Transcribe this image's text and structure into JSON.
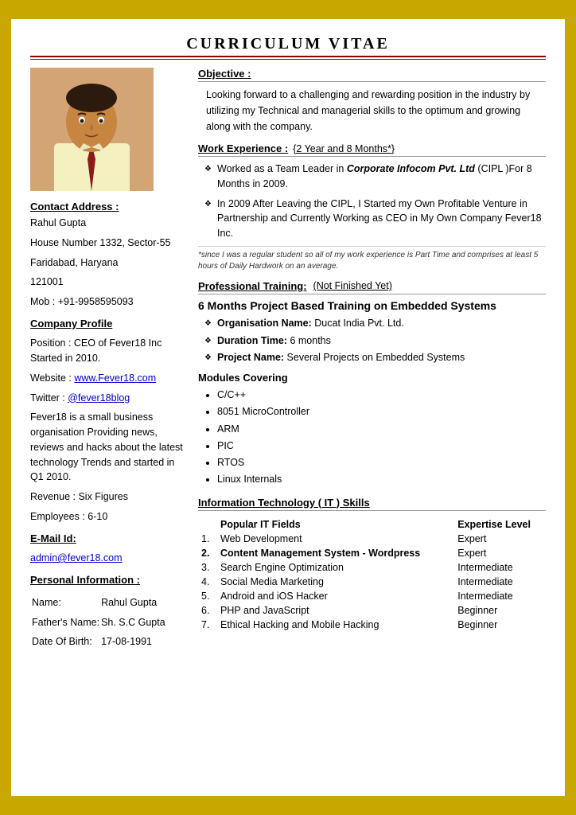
{
  "page": {
    "title": "CURRICULUM VITAE"
  },
  "left": {
    "contact_label": "Contact  Address :",
    "name": "Rahul Gupta",
    "address1": "House Number 1332, Sector-55",
    "address2": "Faridabad, Haryana",
    "pincode": "121001",
    "mobile": "Mob : +91-9958595093",
    "company_profile_label": "Company Profile",
    "position": "Position : CEO of Fever18 Inc Started in 2010.",
    "website_label": "Website : ",
    "website_text": "www.Fever18.com",
    "website_url": "http://www.Fever18.com",
    "twitter_label": "Twitter : ",
    "twitter_text": "@fever18blog",
    "twitter_url": "http://twitter.com/fever18blog",
    "company_desc": "Fever18 is a small business organisation Providing news, reviews and hacks about the latest technology Trends and started in Q1 2010.",
    "revenue": "Revenue : Six Figures",
    "employees": "Employees : 6-10",
    "email_label": "E-Mail Id:",
    "email_text": "admin@fever18.com",
    "email_url": "mailto:admin@fever18.com",
    "personal_label": "Personal   Information :",
    "name_label": "Name:",
    "name_val": "Rahul Gupta",
    "father_label": "Father's Name:",
    "father_val": "Sh. S.C Gupta",
    "dob_label": "Date  Of  Birth:",
    "dob_val": "17-08-1991"
  },
  "right": {
    "objective_label": "Objective :",
    "objective_text": "Looking forward to a challenging and rewarding position in the industry by utilizing my Technical and managerial skills to the optimum and growing along with the company.",
    "work_exp_label": "Work Experience :",
    "work_exp_duration": "{2 Year and 8 Months*}",
    "work_item1_pre": "Worked as a Team Leader in ",
    "work_item1_italic": "Corporate Infocom Pvt. Ltd",
    "work_item1_post": " (CIPL )For 8 Months in 2009.",
    "work_item2": "In 2009 After Leaving the CIPL, I Started my Own Profitable Venture in Partnership and Currently Working as CEO in My Own Company Fever18 Inc.",
    "work_note": "*since  I was a regular student so all of my work experience is Part Time and comprises at least 5 hours of Daily Hardwork on an average.",
    "prof_training_label": "Professional Training:",
    "prof_training_status": "(Not Finished Yet)",
    "training_title": "6 Months Project Based Training on Embedded Systems",
    "org_label": "Organisation Name:",
    "org_val": "Ducat India Pvt. Ltd.",
    "duration_label": "Duration Time:",
    "duration_val": "6 months",
    "project_label": "Project Name:",
    "project_val": "Several Projects on Embedded Systems",
    "modules_label": "Modules Covering",
    "modules": [
      "C/C++",
      "8051 MicroController",
      "ARM",
      "PIC",
      "RTOS",
      "Linux Internals"
    ],
    "it_skills_label": "Information Technology  ( IT ) Skills",
    "it_col1": "Popular IT Fields",
    "it_col2": "Expertise Level",
    "it_skills": [
      {
        "num": "1.",
        "name": "Web Development",
        "level": "Expert"
      },
      {
        "num": "2.",
        "name": "Content Management System  - Wordpress",
        "level": "Expert",
        "bold": true
      },
      {
        "num": "3.",
        "name": "Search Engine Optimization",
        "level": "Intermediate"
      },
      {
        "num": "4.",
        "name": "Social Media Marketing",
        "level": "Intermediate"
      },
      {
        "num": "5.",
        "name": "Android and iOS Hacker",
        "level": "Intermediate"
      },
      {
        "num": "6.",
        "name": "PHP and JavaScript",
        "level": "Beginner"
      },
      {
        "num": "7.",
        "name": "Ethical Hacking and Mobile Hacking",
        "level": "Beginner"
      }
    ]
  }
}
